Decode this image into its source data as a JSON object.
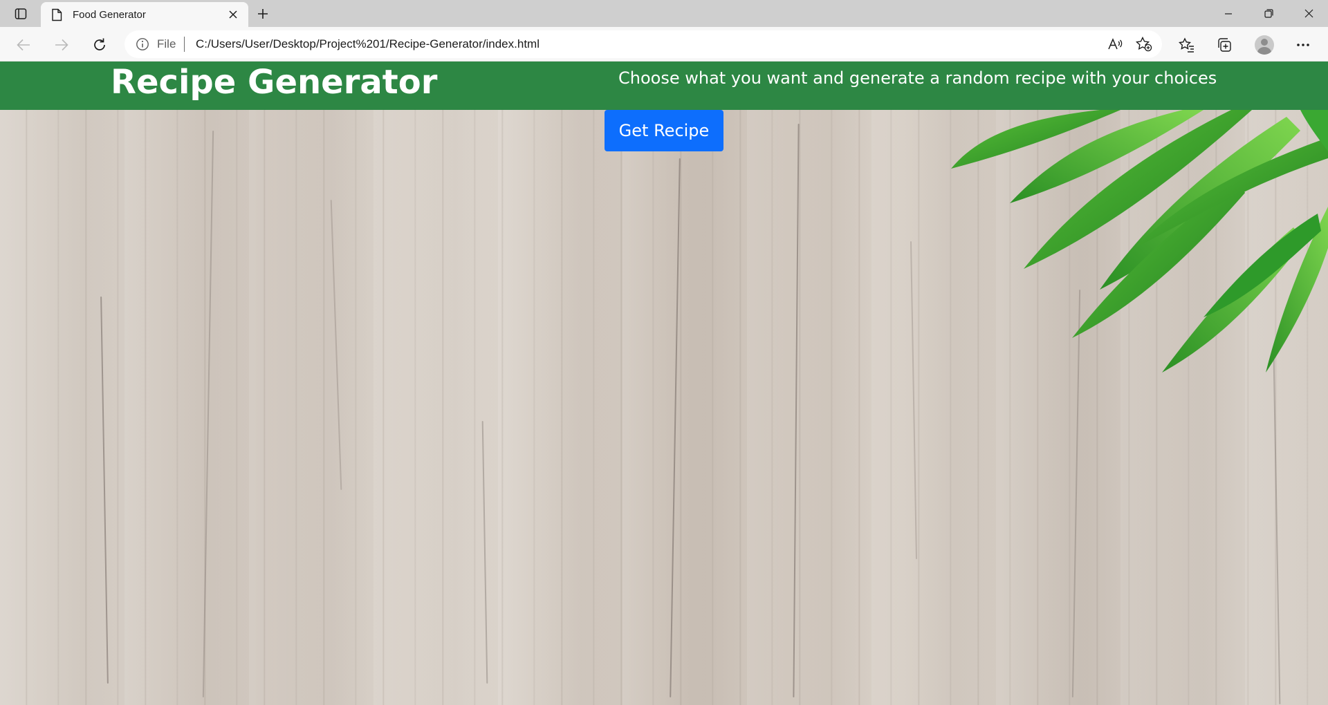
{
  "browser": {
    "tab_title": "Food Generator",
    "address_prefix": "File",
    "url": "C:/Users/User/Desktop/Project%201/Recipe-Generator/index.html",
    "icons": [
      "sidebar-icon",
      "page-icon",
      "close-icon",
      "plus-icon",
      "minimize-icon",
      "restore-icon",
      "close-window-icon",
      "back-icon",
      "forward-icon",
      "refresh-icon",
      "info-icon",
      "read-aloud-icon",
      "add-favorite-icon",
      "favorites-icon",
      "collections-icon",
      "avatar",
      "more-icon"
    ]
  },
  "page": {
    "title": "Recipe Generator",
    "tagline": "Choose what you want and generate a random recipe with your choices",
    "button_label": "Get Recipe"
  },
  "colors": {
    "header": "#2d8744",
    "button": "#0d6efd",
    "leaf": "#3fae2a"
  }
}
